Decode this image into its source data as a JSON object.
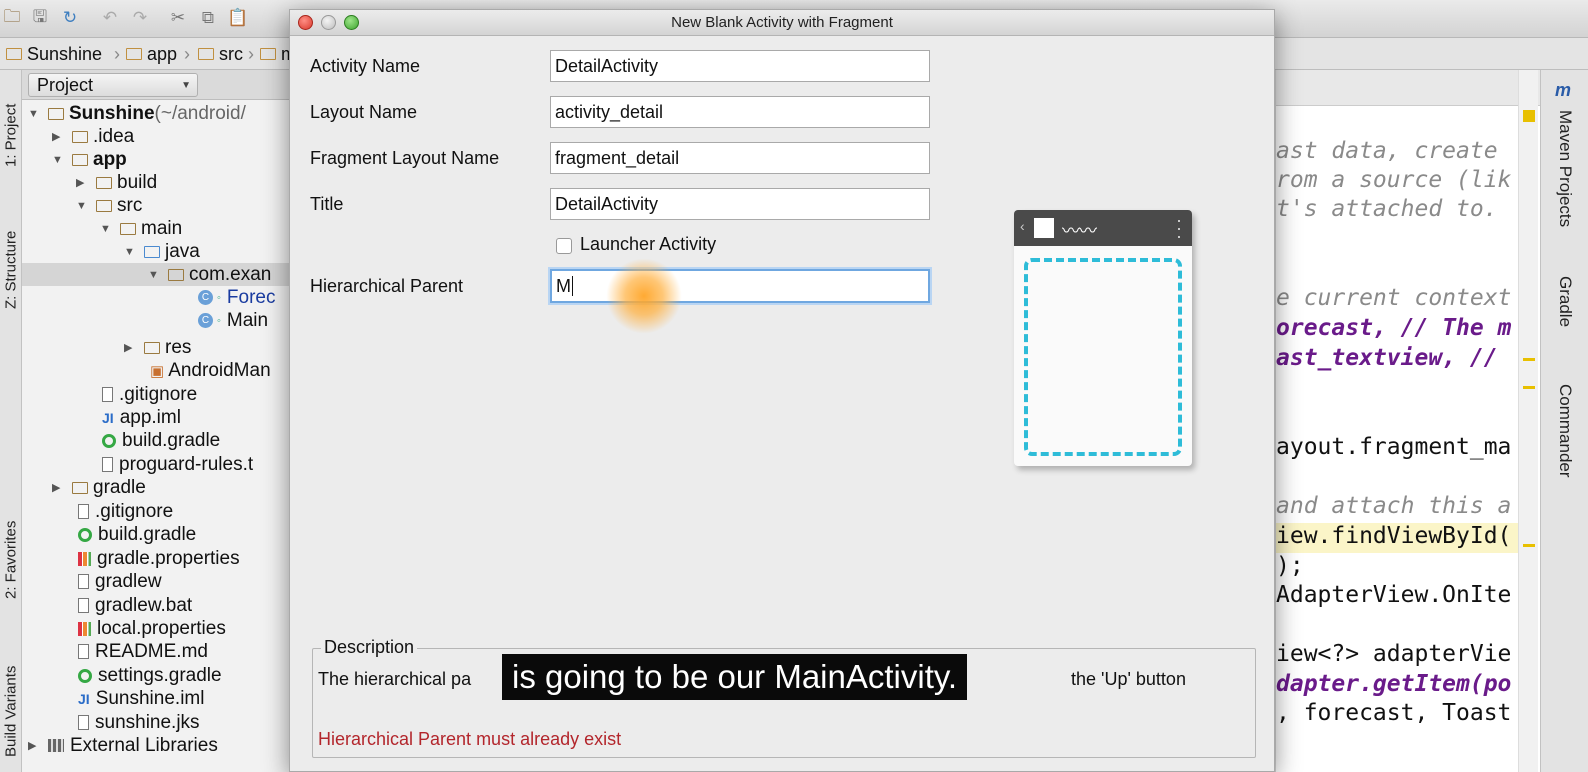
{
  "breadcrumb": [
    "Sunshine",
    "app",
    "src",
    "m"
  ],
  "left_strip": {
    "project_tab": "1: Project",
    "structure_tab": "Z: Structure",
    "favorites_tab": "2: Favorites",
    "build_variants_tab": "Build Variants"
  },
  "project_panel": {
    "view_selector": "Project",
    "tree": [
      {
        "label": "Sunshine",
        "suffix": " (~/android/",
        "bold": true
      },
      {
        "label": ".idea"
      },
      {
        "label": "app",
        "bold": true
      },
      {
        "label": "build"
      },
      {
        "label": "src"
      },
      {
        "label": "main"
      },
      {
        "label": "java"
      },
      {
        "label": "com.exan"
      },
      {
        "label": "Forec"
      },
      {
        "label": "Main"
      },
      {
        "label": "res"
      },
      {
        "label": "AndroidMan"
      },
      {
        "label": ".gitignore"
      },
      {
        "label": "app.iml"
      },
      {
        "label": "build.gradle"
      },
      {
        "label": "proguard-rules.t"
      },
      {
        "label": "gradle"
      },
      {
        "label": ".gitignore"
      },
      {
        "label": "build.gradle"
      },
      {
        "label": "gradle.properties"
      },
      {
        "label": "gradlew"
      },
      {
        "label": "gradlew.bat"
      },
      {
        "label": "local.properties"
      },
      {
        "label": "README.md"
      },
      {
        "label": "settings.gradle"
      },
      {
        "label": "Sunshine.iml"
      },
      {
        "label": "sunshine.jks"
      },
      {
        "label": "External Libraries"
      }
    ]
  },
  "editor": {
    "lines": [
      "ast data, create",
      "rom a source (lik",
      "t's attached to.",
      "e current context",
      "orecast, // The m",
      "ast_textview, //",
      "ayout.fragment_ma",
      "and attach this a",
      "iew.findViewById(",
      ");",
      "AdapterView.OnIte",
      "iew<?> adapterVie",
      "dapter.getItem(po",
      ", forecast, Toast"
    ]
  },
  "right_strip": {
    "m_label": "m",
    "maven_tab": "Maven Projects",
    "gradle_tab": "Gradle",
    "commander_tab": "Commander"
  },
  "dialog": {
    "title": "New Blank Activity with Fragment",
    "fields": {
      "activity_name": {
        "label": "Activity Name",
        "value": "DetailActivity"
      },
      "layout_name": {
        "label": "Layout Name",
        "value": "activity_detail"
      },
      "fragment_layout_name": {
        "label": "Fragment Layout Name",
        "value": "fragment_detail"
      },
      "title": {
        "label": "Title",
        "value": "DetailActivity"
      },
      "launcher_activity": {
        "label": "Launcher Activity",
        "checked": false
      },
      "hierarchical_parent": {
        "label": "Hierarchical Parent",
        "value": "M"
      }
    },
    "description": {
      "heading": "Description",
      "text_left": "The hierarchical pa",
      "text_right": "the 'Up' button",
      "error": "Hierarchical Parent must already exist"
    }
  },
  "caption": "is going to be our MainActivity.",
  "colors": {
    "accent_focus": "#6fa7e0",
    "error": "#b3262c",
    "fragment_dash": "#2ebcd8"
  }
}
